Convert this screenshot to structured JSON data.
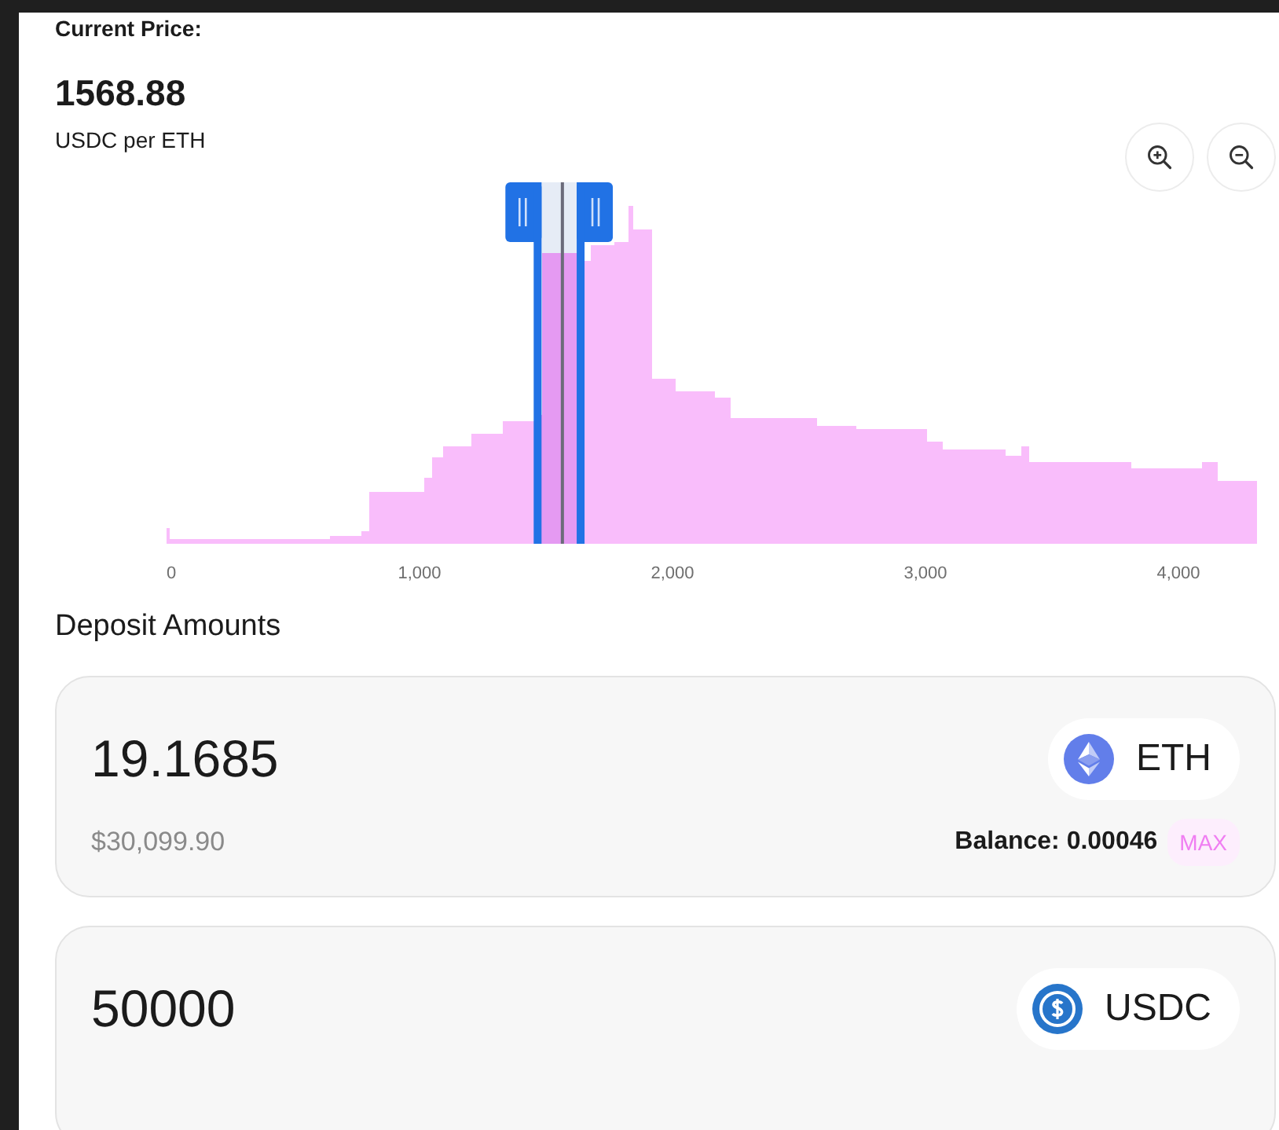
{
  "current_price": {
    "label": "Current Price:",
    "value": "1568.88",
    "unit": "USDC per ETH"
  },
  "zoom_buttons": [
    {
      "kind": "zoom_in"
    },
    {
      "kind": "zoom_out"
    }
  ],
  "chart": {
    "price_marker": {
      "level": 0.363
    },
    "range_handles": [
      {
        "level": 0.341
      },
      {
        "level": 0.379
      }
    ],
    "x_ticks": [
      "0",
      "1,000",
      "2,000",
      "3,000",
      "4,000"
    ]
  },
  "deposit": {
    "title": "Deposit Amounts",
    "cards": [
      {
        "amount": "19.1685",
        "token": "ETH",
        "kind": "eth",
        "usd_value": "$30,099.90",
        "balance": "Balance: 0.00046",
        "max": "MAX"
      },
      {
        "amount": "50000",
        "token": "USDC",
        "kind": "usdc"
      }
    ]
  }
}
